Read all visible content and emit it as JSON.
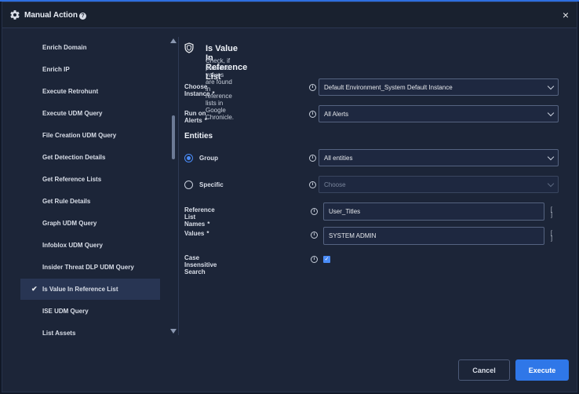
{
  "window": {
    "title": "Manual Action",
    "close_symbol": "×"
  },
  "sidebar": {
    "items": [
      {
        "label": "Enrich Domain"
      },
      {
        "label": "Enrich IP"
      },
      {
        "label": "Execute Retrohunt"
      },
      {
        "label": "Execute UDM Query"
      },
      {
        "label": "File Creation UDM Query"
      },
      {
        "label": "Get Detection Details"
      },
      {
        "label": "Get Reference Lists"
      },
      {
        "label": "Get Rule Details"
      },
      {
        "label": "Graph UDM Query"
      },
      {
        "label": "Infoblox UDM Query"
      },
      {
        "label": "Insider Threat DLP UDM Query"
      },
      {
        "label": "Is Value In Reference List",
        "selected": true
      },
      {
        "label": "ISE UDM Query"
      },
      {
        "label": "List Assets"
      }
    ]
  },
  "action": {
    "title": "Is Value In Reference List",
    "description": "Check, if provided values are found in reference lists in Google Chronicle."
  },
  "form": {
    "choose_instance": {
      "label": "Choose Instance",
      "required_mark": "*",
      "value": "Default Environment_System Default Instance"
    },
    "run_on_alerts": {
      "label": "Run on Alerts",
      "required_mark": "*",
      "value": "All Alerts"
    },
    "entities_heading": "Entities",
    "group": {
      "label": "Group",
      "value": "All entities",
      "selected": true
    },
    "specific": {
      "label": "Specific",
      "placeholder": "Choose",
      "selected": false
    },
    "reference_list_names": {
      "label": "Reference List Names",
      "required_mark": "*",
      "value": "User_Titles"
    },
    "values": {
      "label": "Values",
      "required_mark": "*",
      "value": "SYSTEM ADMIN"
    },
    "case_insensitive": {
      "label": "Case Insensitive Search",
      "checked": true
    },
    "list_bracket": "[ ]",
    "info_glyph": "i"
  },
  "footer": {
    "cancel_label": "Cancel",
    "execute_label": "Execute"
  },
  "colors": {
    "accent": "#2f77e8",
    "background": "#1c2538",
    "selected_item": "#283553"
  }
}
